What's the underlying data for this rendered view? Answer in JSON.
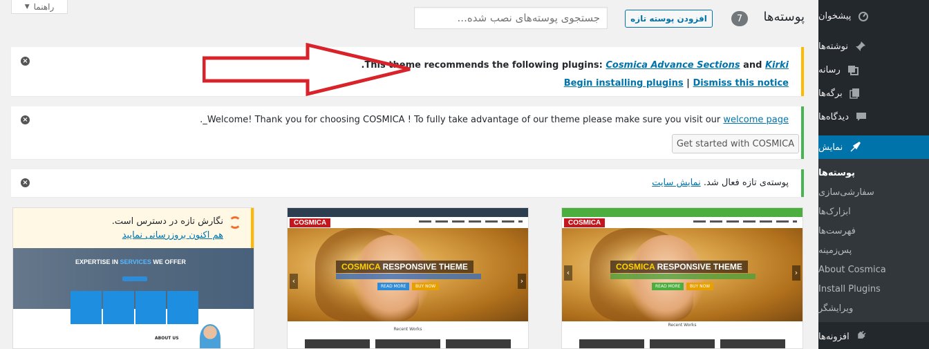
{
  "help_tab": {
    "label": "راهنما"
  },
  "header": {
    "title": "پوسته‌ها",
    "count": "7",
    "add_new_label": "افزودن پوسته تازه",
    "search_placeholder": "جستجوی پوسته‌های نصب شده..."
  },
  "notices": {
    "plugins": {
      "prefix": "This theme recommends the following plugins: ",
      "plugin1": "Cosmica Advance Sections",
      "and": " and ",
      "plugin2": "Kirki",
      "suffix": ".",
      "begin_link": "Begin installing plugins",
      "separator": " | ",
      "dismiss_link": "Dismiss this notice"
    },
    "welcome": {
      "text": "Welcome! Thank you for choosing COSMICA ! To fully take advantage of our theme please make sure you visit our ",
      "link": "welcome page",
      "suffix": "._",
      "button": "Get started with COSMICA"
    },
    "activated": {
      "text": "پوسته‌ی تازه فعال شد. ",
      "link": "نمایش سایت"
    }
  },
  "sidebar": {
    "items": [
      {
        "label": "پیشخوان",
        "icon": "dashboard-icon"
      },
      {
        "label": "نوشته‌ها",
        "icon": "pin-icon"
      },
      {
        "label": "رسانه",
        "icon": "media-icon"
      },
      {
        "label": "برگه‌ها",
        "icon": "pages-icon"
      },
      {
        "label": "دیدگاه‌ها",
        "icon": "comments-icon"
      },
      {
        "label": "نمایش",
        "icon": "appearance-icon"
      }
    ],
    "submenu": [
      "پوسته‌ها",
      "سفارشی‌سازی",
      "ابزارک‌ها",
      "فهرست‌ها",
      "پس‌زمینه",
      "About Cosmica",
      "Install Plugins",
      "ویرایشگر"
    ],
    "plugins_item": {
      "label": "افزونه‌ها",
      "icon": "plugins-icon"
    }
  },
  "themes": {
    "card1": {
      "logo": "COSMICA",
      "hero_title_a": "COSMICA",
      "hero_title_b": " RESPONSIVE THEME",
      "read_more": "READ MORE",
      "buy_now": "BUY NOW",
      "section": "Recent Works"
    },
    "card2": {
      "logo": "COSMICA",
      "hero_title_a": "COSMICA",
      "hero_title_b": " RESPONSIVE THEME",
      "read_more": "READ MORE",
      "buy_now": "BUY NOW",
      "section": "Recent Works"
    },
    "card3": {
      "update_line1": "نگارش تازه در دسترس است.",
      "update_line2": "هم اکنون بروزرسانی نمایید",
      "hero_a": "EXPERTISE IN ",
      "hero_b": "SERVICES",
      "hero_c": " WE OFFER",
      "about": "ABOUT US"
    }
  },
  "colors": {
    "accent": "#0073aa",
    "warning": "#ffb900",
    "success": "#46b450",
    "sidebar_bg": "#23282d",
    "arrow": "#d9232a"
  }
}
